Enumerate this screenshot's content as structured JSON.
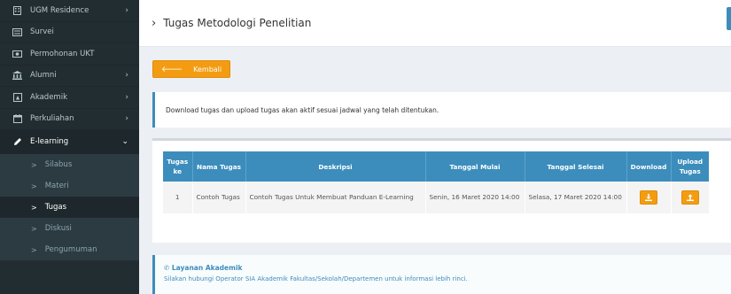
{
  "sidebar": {
    "items": [
      {
        "label": "UGM Residence",
        "icon": "building-icon",
        "chevron": "›"
      },
      {
        "label": "Survei",
        "icon": "list-icon",
        "chevron": ""
      },
      {
        "label": "Permohonan UKT",
        "icon": "money-icon",
        "chevron": ""
      },
      {
        "label": "Alumni",
        "icon": "bank-icon",
        "chevron": "›"
      },
      {
        "label": "Akademik",
        "icon": "book-icon",
        "chevron": "›"
      },
      {
        "label": "Perkuliahan",
        "icon": "calendar-icon",
        "chevron": "›"
      },
      {
        "label": "E-learning",
        "icon": "pencil-icon",
        "chevron": "⌄"
      }
    ],
    "subitems": [
      {
        "label": "Silabus"
      },
      {
        "label": "Materi"
      },
      {
        "label": "Tugas"
      },
      {
        "label": "Diskusi"
      },
      {
        "label": "Pengumuman"
      }
    ]
  },
  "header": {
    "title": "Tugas Metodologi Penelitian",
    "arrow": "›"
  },
  "back_button": {
    "label": "Kembali",
    "icon": "arrow-left-icon"
  },
  "info": {
    "text": "Download tugas dan upload tugas akan aktif sesuai jadwal yang telah ditentukan."
  },
  "table": {
    "headers": {
      "no": "Tugas ke",
      "name": "Nama Tugas",
      "desc": "Deskripsi",
      "start": "Tanggal Mulai",
      "end": "Tanggal Selesai",
      "download": "Download",
      "upload": "Upload Tugas"
    },
    "rows": [
      {
        "no": "1",
        "name": "Contoh Tugas",
        "desc": "Contoh Tugas Untuk Membuat Panduan E-Learning",
        "start": "Senin, 16 Maret 2020 14:00",
        "end": "Selasa, 17 Maret 2020 14:00"
      }
    ]
  },
  "layanan": {
    "title": "Layanan Akademik",
    "icon": "phone-icon",
    "text": "Silakan hubungi Operator SIA Akademik Fakultas/Sekolah/Departemen untuk informasi lebih rinci."
  },
  "colors": {
    "accent": "#3c8dbc",
    "warning": "#f39c12",
    "sidebar": "#222d32"
  }
}
